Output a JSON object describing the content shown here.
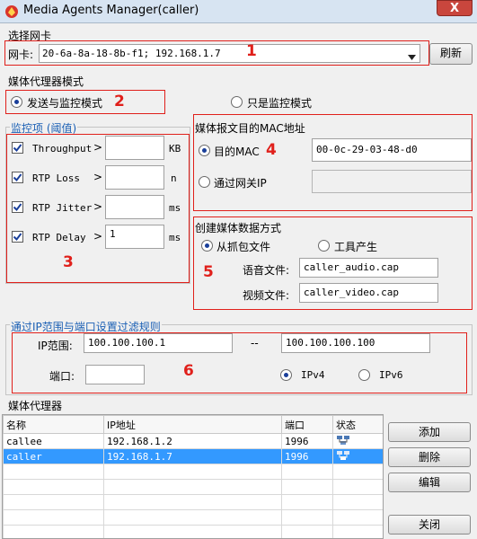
{
  "window": {
    "title": "Media Agents Manager(caller)",
    "close": "X"
  },
  "nic": {
    "group_label": "选择网卡",
    "field_label": "网卡:",
    "value": "20-6a-8a-18-8b-f1;  192.168.1.7",
    "refresh_label": "刷新"
  },
  "mode": {
    "group_label": "媒体代理器模式",
    "send_monitor": "发送与监控模式",
    "monitor_only": "只是监控模式",
    "selected": "send_monitor"
  },
  "monitor": {
    "group_label": "监控项 (阈值)",
    "items": [
      {
        "label": "Throughput",
        "value": "",
        "unit": "KB",
        "checked": true
      },
      {
        "label": "RTP Loss",
        "value": "",
        "unit": "n",
        "checked": true
      },
      {
        "label": "RTP Jitter",
        "value": "",
        "unit": "ms",
        "checked": true
      },
      {
        "label": "RTP Delay",
        "value": "1",
        "unit": "ms",
        "checked": true
      }
    ],
    "arrow": ">"
  },
  "mac": {
    "group_label": "媒体报文目的MAC地址",
    "dest_label": "目的MAC",
    "dest_value": "00-0c-29-03-48-d0",
    "gateway_label": "通过网关IP",
    "gateway_value": ""
  },
  "create": {
    "group_label": "创建媒体数据方式",
    "from_capture": "从抓包文件",
    "from_tool": "工具产生",
    "audio_label": "语音文件:",
    "audio_value": "caller_audio.cap",
    "video_label": "视频文件:",
    "video_value": "caller_video.cap"
  },
  "filter": {
    "group_label": "通过IP范围与端口设置过滤规则",
    "ip_label": "IP范围:",
    "ip_from": "100.100.100.1",
    "separator": "--",
    "ip_to": "100.100.100.100",
    "port_label": "端口:",
    "port_value": "",
    "ipv4": "IPv4",
    "ipv6": "IPv6"
  },
  "agents": {
    "group_label": "媒体代理器",
    "columns": [
      "名称",
      "IP地址",
      "端口",
      "状态"
    ],
    "rows": [
      {
        "name": "callee",
        "ip": "192.168.1.2",
        "port": "1996",
        "status_icon": "network-icon"
      },
      {
        "name": "caller",
        "ip": "192.168.1.7",
        "port": "1996",
        "status_icon": "network-icon"
      }
    ],
    "buttons": {
      "add": "添加",
      "delete": "删除",
      "edit": "编辑",
      "close": "关闭"
    }
  },
  "annotations": [
    "1",
    "2",
    "3",
    "4",
    "5",
    "6"
  ],
  "colors": {
    "annotation_red": "#e0201b",
    "selection_blue": "#3399ff"
  }
}
